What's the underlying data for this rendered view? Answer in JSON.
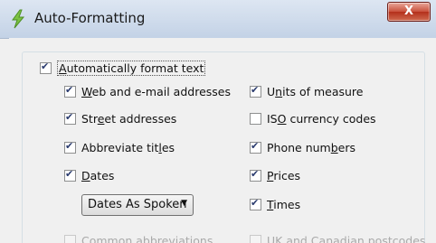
{
  "window": {
    "title": "Auto-Formatting",
    "close_label": "X"
  },
  "main_option": {
    "label": "Automatically format text",
    "checked": true
  },
  "left_options": [
    {
      "label": "Web and e-mail addresses",
      "checked": true
    },
    {
      "label": "Street addresses",
      "checked": true
    },
    {
      "label": "Abbreviate titles",
      "checked": true
    },
    {
      "label": "Dates",
      "checked": true
    }
  ],
  "right_options": [
    {
      "label": "Units of measure",
      "checked": true
    },
    {
      "label": "ISO currency codes",
      "checked": false
    },
    {
      "label": "Phone numbers",
      "checked": true
    },
    {
      "label": "Prices",
      "checked": true
    },
    {
      "label": "Times",
      "checked": true
    }
  ],
  "dates_dropdown": {
    "value": "Dates As Spoken"
  },
  "partial_options": [
    {
      "label": "Common abbreviations",
      "checked": false
    },
    {
      "label": "UK and Canadian postcodes",
      "checked": false
    }
  ],
  "colors": {
    "title_bar": "#c9d7ea",
    "close_button": "#c9503b",
    "check": "#2a3b6e"
  }
}
